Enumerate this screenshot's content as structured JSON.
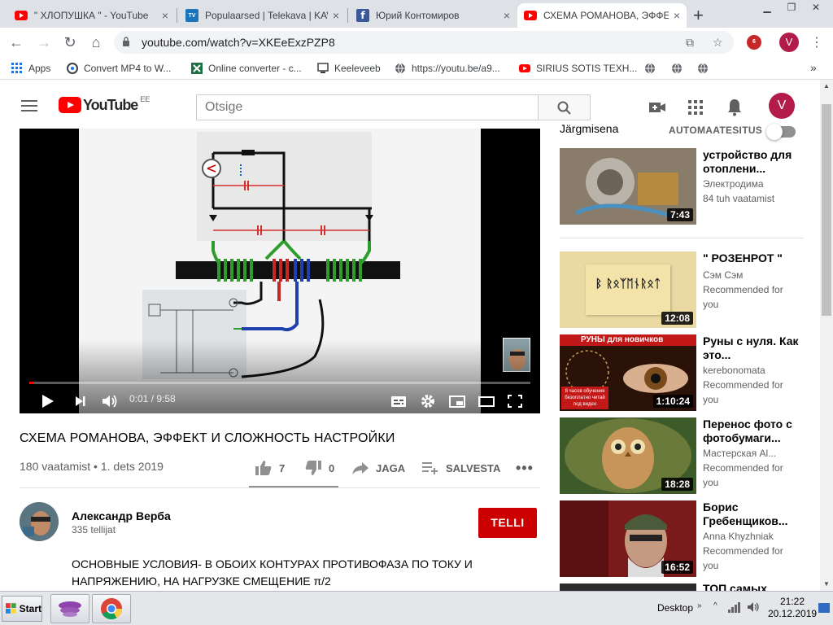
{
  "browser": {
    "tabs": [
      {
        "title": "\" ХЛОПУШКА \" - YouTube",
        "icon": "youtube-favicon"
      },
      {
        "title": "Populaarsed | Telekava | KAVA",
        "icon": "telekava-favicon",
        "fav_text": "TV"
      },
      {
        "title": "Юрий Контомиров",
        "icon": "facebook-favicon",
        "fav_text": "f"
      },
      {
        "title": "СХЕМА РОМАНОВА, ЭФФЕКТ",
        "icon": "youtube-favicon"
      }
    ],
    "url": "youtube.com/watch?v=XKEeExzPZP8",
    "ext_badge": "6",
    "profile_initial": "V",
    "bookmarks": [
      {
        "label": "Apps",
        "icon": "apps-grid-icon"
      },
      {
        "label": "Convert MP4 to W...",
        "icon": "convert-icon"
      },
      {
        "label": "Online converter - c...",
        "icon": "excel-icon"
      },
      {
        "label": "Keeleveeb",
        "icon": "monitor-icon"
      },
      {
        "label": "https://youtu.be/a9...",
        "icon": "globe-icon"
      },
      {
        "label": "SIRIUS SOTIS TEXH...",
        "icon": "youtube-favicon"
      }
    ],
    "more_bookmarks": "»"
  },
  "youtube": {
    "logo_text": "YouTube",
    "country_code": "EE",
    "search_placeholder": "Otsige",
    "avatar_initial": "V"
  },
  "player": {
    "time_current": "0:01",
    "time_total": "9:58",
    "time_sep": " / ",
    "progress": 0.0017,
    "buffered": 0.09
  },
  "video": {
    "title": "СХЕМА РОМАНОВА, ЭФФЕКТ И СЛОЖНОСТЬ НАСТРОЙКИ",
    "views": "180 vaatamist",
    "date": "1. dets 2019",
    "meta_sep": " • ",
    "likes": "7",
    "dislikes": "0",
    "share_label": "JAGA",
    "save_label": "SALVESTA"
  },
  "channel": {
    "name": "Александр Верба",
    "subs": "335 tellijat",
    "subscribe_label": "TELLI"
  },
  "description": {
    "line1": "ОСНОВНЫЕ УСЛОВИЯ-  В ОБОИХ КОНТУРАХ ПРОТИВОФАЗА ПО ТОКУ И",
    "line2": "НАПРЯЖЕНИЮ, НА НАГРУЗКЕ СМЕЩЕНИЕ  π/2"
  },
  "sidebar": {
    "upnext_label": "Järgmisena",
    "autoplay_label": "AUTOMAATESITUS",
    "items": [
      {
        "title": "устройство для отоплени...",
        "channel": "Электродима",
        "meta": "84 tuh vaatamist",
        "duration": "7:43"
      },
      {
        "title": "\" РОЗЕНРОТ \"",
        "channel": "Сэм Сэм",
        "meta": "Recommended for you",
        "duration": "12:08",
        "thumb_text": "ᛒ ᚱᛟᛉᛖᚾᚱᛟᛏ"
      },
      {
        "title": "Руны с нуля. Как это...",
        "channel": "kerebonomata",
        "meta": "Recommended for you",
        "duration": "1:10:24",
        "thumb_top": "РУНЫ для новичков",
        "thumb_bottom": "8 часов обучения безоплатно читай под видео"
      },
      {
        "title": "Перенос фото с фотобумаги...",
        "channel": "Мастерская Al...",
        "meta": "Recommended for you",
        "duration": "18:28"
      },
      {
        "title": "Борис Гребенщиков...",
        "channel": "Anna Khyzhniak",
        "meta": "Recommended for you",
        "duration": "16:52"
      },
      {
        "title": "ТОП самых"
      }
    ]
  },
  "taskbar": {
    "start_label": "Start",
    "desktop_label": "Desktop",
    "time": "21:22",
    "date": "20.12.2019"
  },
  "colors": {
    "yt_red": "#ff0000",
    "subscribe_red": "#cc0000",
    "avatar": "#b31b4a"
  }
}
